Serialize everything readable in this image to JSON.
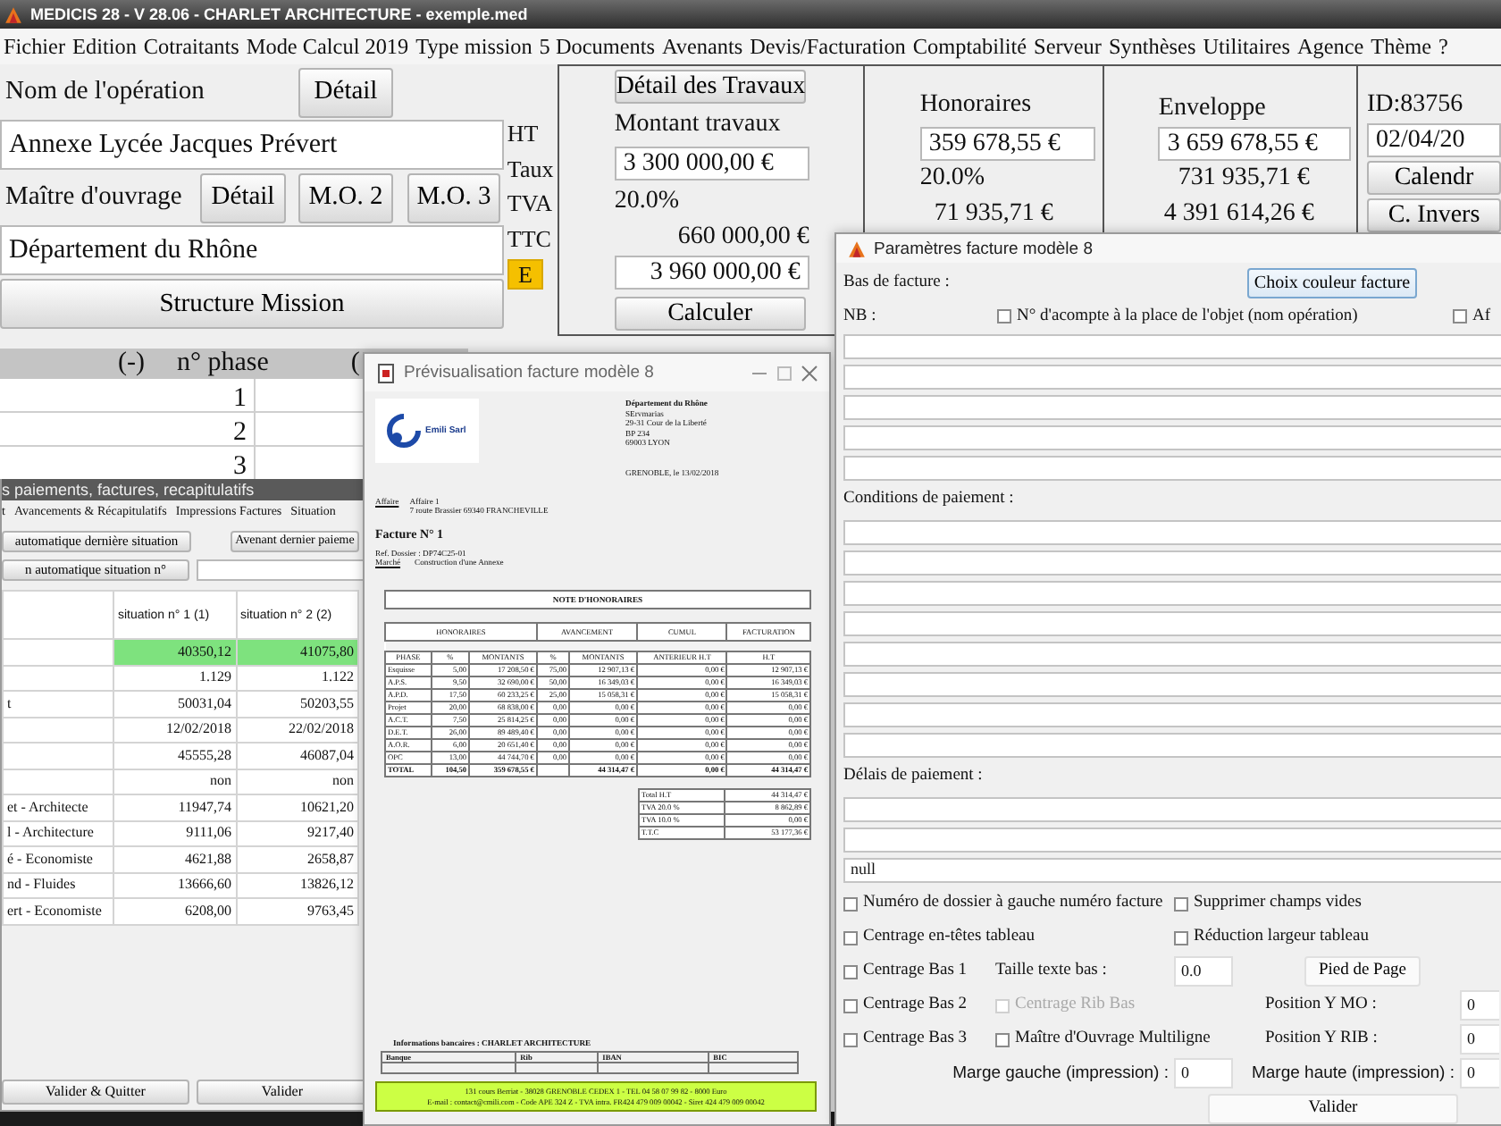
{
  "window": {
    "title": "MEDICIS 28  - V 28.06 - CHARLET ARCHITECTURE - exemple.med"
  },
  "menu": [
    "Fichier",
    "Edition",
    "Cotraitants",
    "Mode Calcul 2019",
    "Type mission",
    "5 Documents",
    "Avenants",
    "Devis/Facturation",
    "Comptabilité",
    "Serveur",
    "Synthèses",
    "Utilitaires",
    "Agence",
    "Thème",
    "?"
  ],
  "operation": {
    "name_label": "Nom de l'opération",
    "name_button": "Détail",
    "name_value": "Annexe Lycée Jacques Prévert",
    "owner_label": "Maître d'ouvrage",
    "owner_buttons": [
      "Détail",
      "M.O. 2",
      "M.O. 3"
    ],
    "owner_value": "Département du Rhône",
    "structure_button": "Structure Mission"
  },
  "row_labels": [
    {
      "text": "HT",
      "highlight": false
    },
    {
      "text": "Taux",
      "highlight": false
    },
    {
      "text": "TVA",
      "highlight": false
    },
    {
      "text": "TTC",
      "highlight": false
    },
    {
      "text": "E",
      "highlight": true
    }
  ],
  "travaux": {
    "button": "Détail des Travaux",
    "label": "Montant travaux",
    "ht": "3 300 000,00 €",
    "taux": "20.0%",
    "tva": "660 000,00 €",
    "ttc": "3 960 000,00 €",
    "calc_button": "Calculer"
  },
  "honoraires": {
    "title": "Honoraires",
    "ht": "359 678,55 €",
    "taux": "20.0%",
    "tva": "71 935,71 €"
  },
  "enveloppe": {
    "title": "Enveloppe",
    "ht": "3 659 678,55 €",
    "tva": "731 935,71 €",
    "ttc": "4 391 614,26 €"
  },
  "dossier": {
    "id": "ID:83756",
    "date": "02/04/20",
    "buttons": [
      "Calendr",
      "C. Invers"
    ]
  },
  "phase_table": {
    "columns": [
      "(-)",
      "n° phase",
      "("
    ],
    "rows": [
      "1",
      "2",
      "3"
    ]
  },
  "payments_window": {
    "title": "s paiements, factures, recapitulatifs",
    "tabs": [
      "t",
      "Avancements & Récapitulatifs",
      "Impressions Factures",
      "Situation"
    ],
    "buttons": [
      "automatique dernière situation",
      "Avenant dernier paieme",
      "n automatique situation n°"
    ],
    "columns": [
      "situation n° 1 (1)",
      "situation n° 2 (2)"
    ],
    "rows": [
      {
        "values": [
          "40350,12",
          "41075,80"
        ],
        "highlight": true
      },
      {
        "values": [
          "1.129",
          "1.122"
        ],
        "highlight": false
      },
      {
        "label": "t",
        "values": [
          "50031,04",
          "50203,55"
        ],
        "highlight": false
      },
      {
        "values": [
          "12/02/2018",
          "22/02/2018"
        ],
        "highlight": false
      },
      {
        "values": [
          "45555,28",
          "46087,04"
        ],
        "highlight": false
      },
      {
        "values": [
          "non",
          "non"
        ],
        "highlight": false
      },
      {
        "label": "et - Architecte",
        "values": [
          "11947,74",
          "10621,20"
        ],
        "highlight": false
      },
      {
        "label": "l - Architecture",
        "values": [
          "9111,06",
          "9217,40"
        ],
        "highlight": false
      },
      {
        "label": "é - Economiste",
        "values": [
          "4621,88",
          "2658,87"
        ],
        "highlight": false
      },
      {
        "label": "nd - Fluides",
        "values": [
          "13666,60",
          "13826,12"
        ],
        "highlight": false
      },
      {
        "label": "ert - Economiste",
        "values": [
          "6208,00",
          "9763,45"
        ],
        "highlight": false
      }
    ],
    "bottom_buttons": [
      "Valider & Quitter",
      "Valider"
    ]
  },
  "preview_window": {
    "title": "Prévisualisation facture modèle 8",
    "logo_text": "Emili Sarl",
    "recipient": [
      "Département du Rhône",
      "SErvmarias",
      "29-31 Cour de la Liberté",
      "BP 234",
      "69003 LYON"
    ],
    "place_date": "GRENOBLE, le 13/02/2018",
    "affaire_label": "Affaire",
    "affaire_lines": [
      "Affaire 1",
      "7 route Brassier 69340 FRANCHEVILLE"
    ],
    "invoice_title": "Facture N° 1",
    "ref": "Ref. Dossier : DP74C25-01",
    "market_label": "Marché",
    "market_value": "Construction d'une Annexe",
    "note_title": "NOTE D'HONORAIRES",
    "groups": [
      "HONORAIRES",
      "AVANCEMENT",
      "CUMUL",
      "FACTURATION"
    ],
    "columns": [
      "PHASE",
      "%",
      "MONTANTS",
      "%",
      "MONTANTS",
      "ANTERIEUR H.T",
      "H.T"
    ],
    "rows": [
      [
        "Esquisse",
        "5,00",
        "17 208,50 €",
        "75,00",
        "12 907,13 €",
        "0,00 €",
        "12 907,13 €"
      ],
      [
        "A.P.S.",
        "9,50",
        "32 690,00 €",
        "50,00",
        "16 349,03 €",
        "0,00 €",
        "16 349,03 €"
      ],
      [
        "A.P.D.",
        "17,50",
        "60 233,25 €",
        "25,00",
        "15 058,31 €",
        "0,00 €",
        "15 058,31 €"
      ],
      [
        "Projet",
        "20,00",
        "68 838,00 €",
        "0,00",
        "0,00 €",
        "0,00 €",
        "0,00 €"
      ],
      [
        "A.C.T.",
        "7,50",
        "25 814,25 €",
        "0,00",
        "0,00 €",
        "0,00 €",
        "0,00 €"
      ],
      [
        "D.E.T.",
        "26,00",
        "89 489,40 €",
        "0,00",
        "0,00 €",
        "0,00 €",
        "0,00 €"
      ],
      [
        "A.O.R.",
        "6,00",
        "20 651,40 €",
        "0,00",
        "0,00 €",
        "0,00 €",
        "0,00 €"
      ],
      [
        "OPC",
        "13,00",
        "44 744,70 €",
        "0,00",
        "0,00 €",
        "0,00 €",
        "0,00 €"
      ]
    ],
    "total": {
      "label": "TOTAL",
      "percent": "104,50",
      "amount": "359 678,55 €",
      "progress_amount": "44 314,47 €",
      "previous": "0,00 €",
      "invoiced": "44 314,47 €"
    },
    "totals": [
      [
        "Total H.T",
        "44 314,47 €"
      ],
      [
        "TVA 20.0 %",
        "8 862,89 €"
      ],
      [
        "TVA 10.0 %",
        "0,00 €"
      ],
      [
        "T.T.C",
        "53 177,36 €"
      ]
    ],
    "bank_title": "Informations bancaires : CHARLET ARCHITECTURE",
    "bank_columns": [
      "Banque",
      "Rib",
      "IBAN",
      "BIC"
    ],
    "footer_lines": [
      "131 cours Berriat - 38028 GRENOBLE CEDEX 1 - TEL 04 58 07 99 82 - 8000 Euro",
      "E-mail : contact@cmili.com - Code APE 324 Z - TVA intra. FR424 479 009 00042 - Siret 424 479 009 00042"
    ]
  },
  "params_window": {
    "title": "Paramètres facture modèle 8",
    "footer_label": "Bas de facture :",
    "color_button": "Choix couleur facture",
    "nb_label": "NB :",
    "nb_checkboxes": [
      {
        "label": "N° d'acompte à la place de l'objet (nom opération)",
        "checked": false,
        "disabled": false
      },
      {
        "label": "Af",
        "checked": false,
        "disabled": false
      }
    ],
    "conditions_label": "Conditions de paiement :",
    "delays_label": "Délais de paiement :",
    "delay_value": "null",
    "options": [
      [
        {
          "kind": "checkbox",
          "label": "Numéro de dossier à gauche numéro facture",
          "checked": false,
          "disabled": false
        },
        {
          "kind": "checkbox",
          "label": "Supprimer champs vides",
          "checked": false,
          "disabled": false
        }
      ],
      [
        {
          "kind": "checkbox",
          "label": "Centrage en-têtes tableau",
          "checked": false,
          "disabled": false
        },
        {
          "kind": "checkbox",
          "label": "Réduction largeur tableau",
          "checked": false,
          "disabled": false
        }
      ],
      [
        {
          "kind": "checkbox",
          "label": "Centrage Bas 1",
          "checked": false,
          "disabled": false
        },
        {
          "kind": "label",
          "label": "Taille texte bas :"
        },
        {
          "kind": "field",
          "value": "0.0"
        },
        {
          "kind": "button",
          "label": "Pied de Page"
        }
      ],
      [
        {
          "kind": "checkbox",
          "label": "Centrage Bas 2",
          "checked": false,
          "disabled": false
        },
        {
          "kind": "checkbox",
          "label": "Centrage Rib Bas",
          "checked": false,
          "disabled": true
        },
        {
          "kind": "label",
          "label": "Position Y MO :"
        },
        {
          "kind": "field",
          "value": "0"
        }
      ],
      [
        {
          "kind": "checkbox",
          "label": "Centrage Bas 3",
          "checked": false,
          "disabled": false
        },
        {
          "kind": "checkbox",
          "label": "Maître d'Ouvrage Multiligne",
          "checked": false,
          "disabled": false
        },
        {
          "kind": "label",
          "label": "Position Y RIB :"
        },
        {
          "kind": "field",
          "value": "0"
        }
      ],
      [
        {
          "kind": "label",
          "label": "Marge gauche (impression) :"
        },
        {
          "kind": "field",
          "value": "0"
        },
        {
          "kind": "label",
          "label": "Marge haute (impression) :"
        },
        {
          "kind": "field",
          "value": "0"
        }
      ]
    ],
    "validate_button": "Valider"
  }
}
